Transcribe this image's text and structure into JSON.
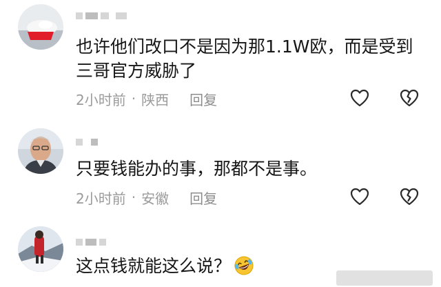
{
  "comments": [
    {
      "text": "也许他们改口不是因为那1.1W欧，而是受到三哥官方威胁了",
      "time": "2小时前",
      "separator": "·",
      "location": "陕西",
      "reply_label": "回复"
    },
    {
      "text": "只要钱能办的事，那都不是事。",
      "time": "2小时前",
      "separator": "·",
      "location": "安徽",
      "reply_label": "回复"
    },
    {
      "text": "这点钱就能这么说？",
      "emoji": "rofl-emoji"
    }
  ],
  "icons": {
    "like": "heart-outline-icon",
    "dislike": "broken-heart-icon"
  },
  "colors": {
    "text": "#161616",
    "meta": "#9a9a9a",
    "icon_stroke": "#2a2a2a",
    "background": "#ffffff"
  }
}
